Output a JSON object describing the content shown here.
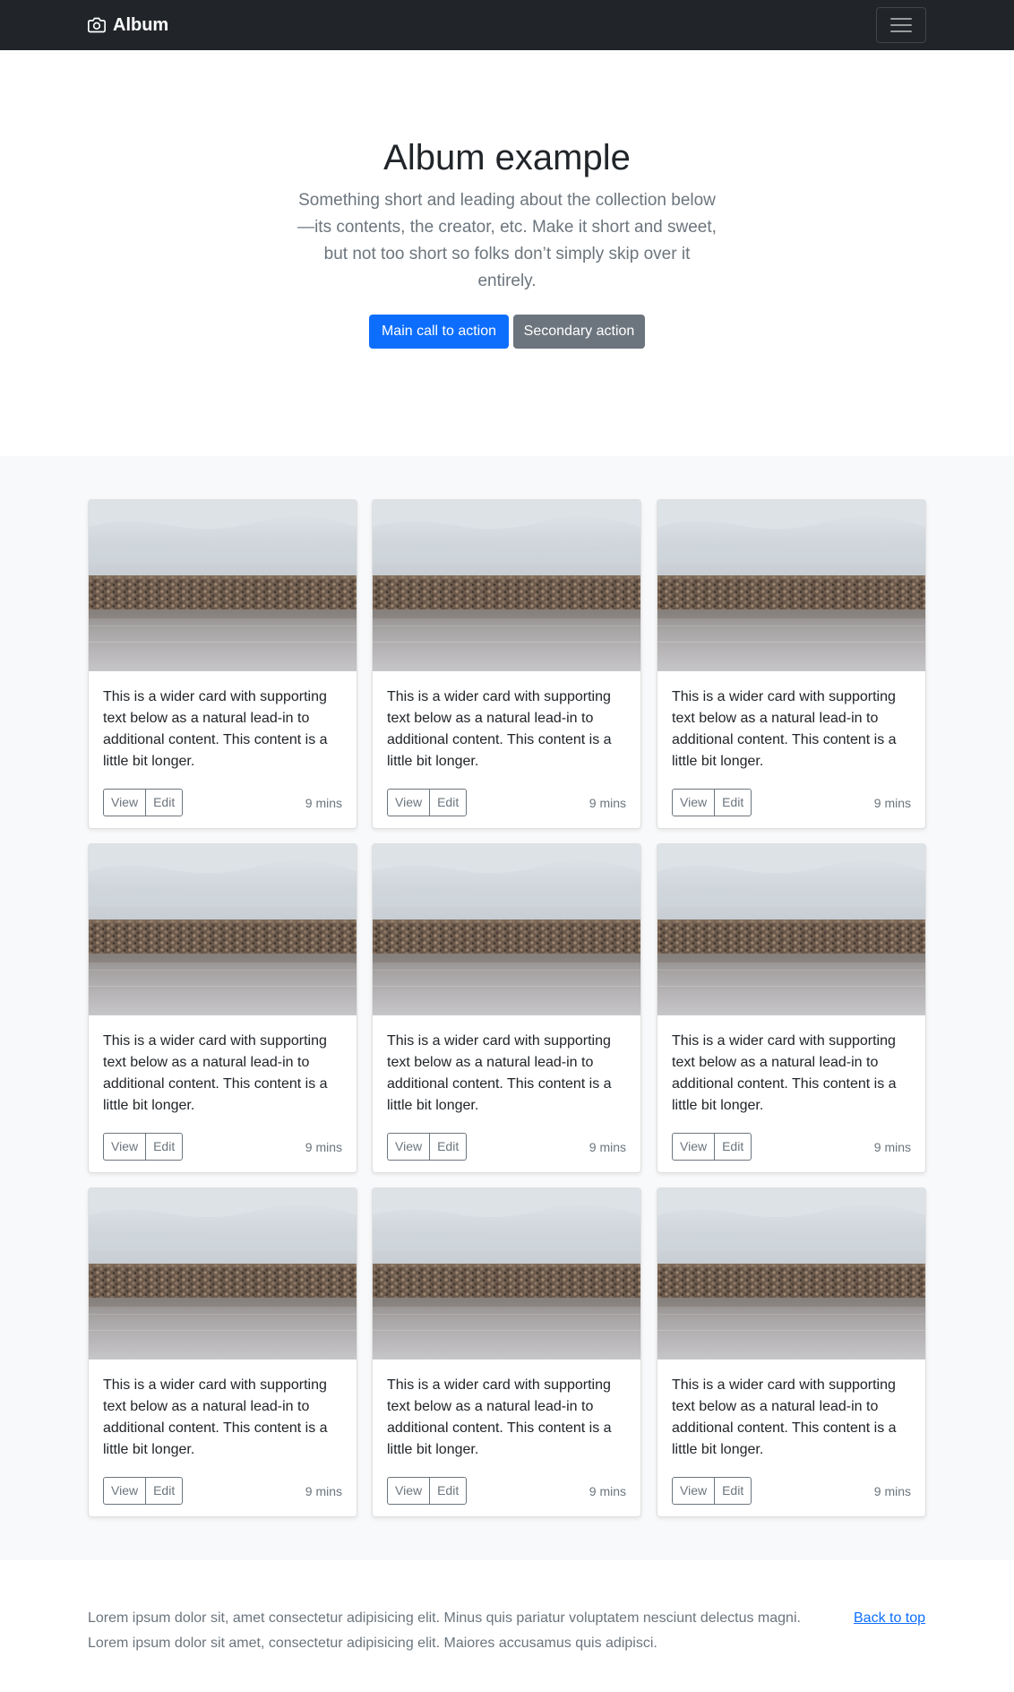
{
  "navbar": {
    "brand": "Album",
    "brand_icon": "camera-icon",
    "toggler_icon": "hamburger-menu-icon"
  },
  "hero": {
    "title": "Album example",
    "lead": "Something short and leading about the collection below—its contents, the creator, etc. Make it short and sweet, but not too short so folks don’t simply skip over it entirely.",
    "primary_label": "Main call to action",
    "secondary_label": "Secondary action"
  },
  "cards": [
    {
      "text": "This is a wider card with supporting text below as a natural lead-in to additional content. This content is a little bit longer.",
      "view_label": "View",
      "edit_label": "Edit",
      "time": "9 mins"
    },
    {
      "text": "This is a wider card with supporting text below as a natural lead-in to additional content. This content is a little bit longer.",
      "view_label": "View",
      "edit_label": "Edit",
      "time": "9 mins"
    },
    {
      "text": "This is a wider card with supporting text below as a natural lead-in to additional content. This content is a little bit longer.",
      "view_label": "View",
      "edit_label": "Edit",
      "time": "9 mins"
    },
    {
      "text": "This is a wider card with supporting text below as a natural lead-in to additional content. This content is a little bit longer.",
      "view_label": "View",
      "edit_label": "Edit",
      "time": "9 mins"
    },
    {
      "text": "This is a wider card with supporting text below as a natural lead-in to additional content. This content is a little bit longer.",
      "view_label": "View",
      "edit_label": "Edit",
      "time": "9 mins"
    },
    {
      "text": "This is a wider card with supporting text below as a natural lead-in to additional content. This content is a little bit longer.",
      "view_label": "View",
      "edit_label": "Edit",
      "time": "9 mins"
    },
    {
      "text": "This is a wider card with supporting text below as a natural lead-in to additional content. This content is a little bit longer.",
      "view_label": "View",
      "edit_label": "Edit",
      "time": "9 mins"
    },
    {
      "text": "This is a wider card with supporting text below as a natural lead-in to additional content. This content is a little bit longer.",
      "view_label": "View",
      "edit_label": "Edit",
      "time": "9 mins"
    },
    {
      "text": "This is a wider card with supporting text below as a natural lead-in to additional content. This content is a little bit longer.",
      "view_label": "View",
      "edit_label": "Edit",
      "time": "9 mins"
    }
  ],
  "footer": {
    "text": "Lorem ipsum dolor sit, amet consectetur adipisicing elit. Minus quis pariatur voluptatem nesciunt delectus magni. Lorem ipsum dolor sit amet, consectetur adipisicing elit. Maiores accusamus quis adipisci.",
    "back_to_top": "Back to top"
  },
  "colors": {
    "navbar_bg": "#212529",
    "primary": "#0d6efd",
    "secondary": "#6c757d",
    "album_bg": "#f8f9fa"
  }
}
